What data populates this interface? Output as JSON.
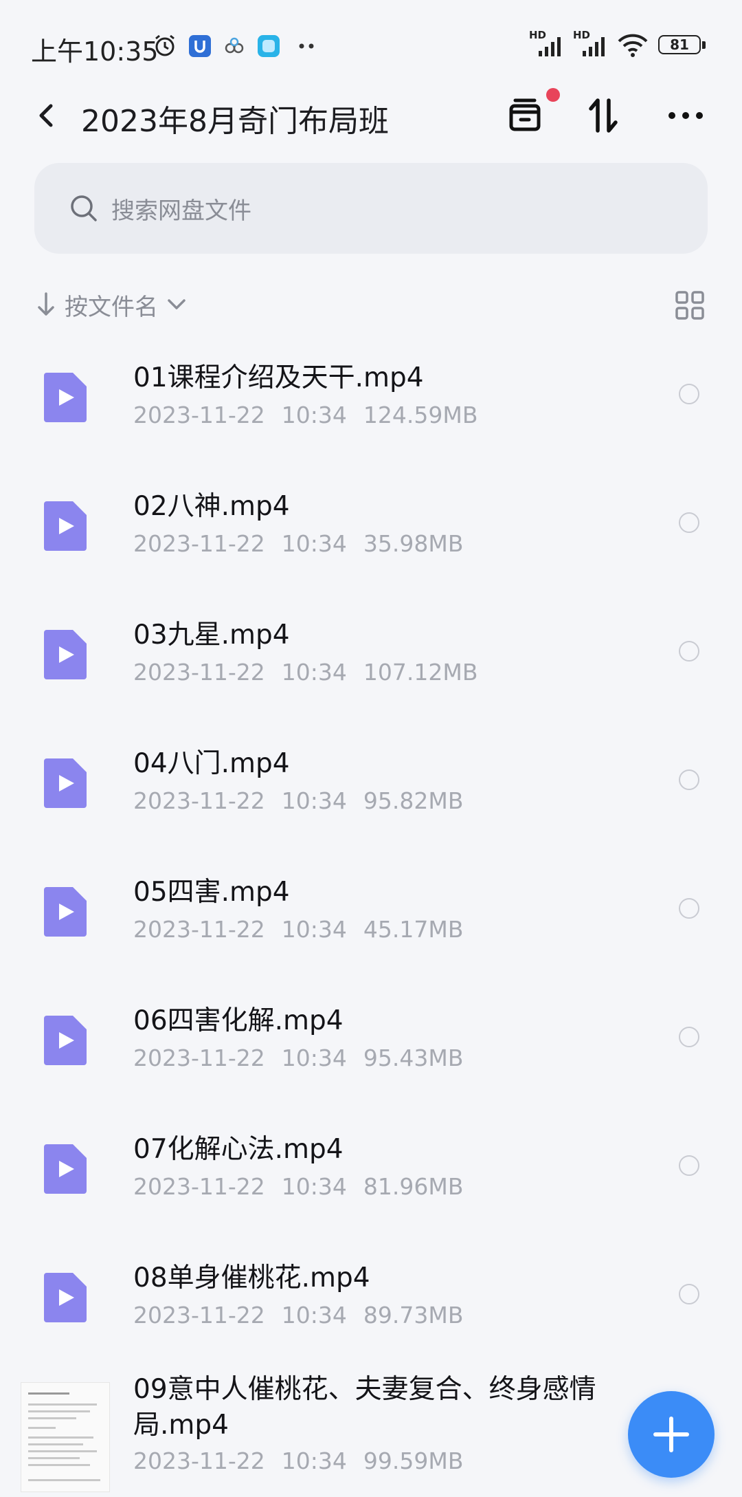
{
  "status_bar": {
    "time": "上午10:35",
    "signal1_label": "HD",
    "signal2_label": "HD",
    "battery": "81"
  },
  "header": {
    "title": "2023年8月奇门布局班",
    "notification_dot_color": "#e8445a"
  },
  "search": {
    "placeholder": "搜索网盘文件"
  },
  "sort": {
    "label": "按文件名"
  },
  "files": [
    {
      "name": "01课程介绍及天干.mp4",
      "date": "2023-11-22",
      "time": "10:34",
      "size": "124.59MB"
    },
    {
      "name": "02八神.mp4",
      "date": "2023-11-22",
      "time": "10:34",
      "size": "35.98MB"
    },
    {
      "name": "03九星.mp4",
      "date": "2023-11-22",
      "time": "10:34",
      "size": "107.12MB"
    },
    {
      "name": "04八门.mp4",
      "date": "2023-11-22",
      "time": "10:34",
      "size": "95.82MB"
    },
    {
      "name": "05四害.mp4",
      "date": "2023-11-22",
      "time": "10:34",
      "size": "45.17MB"
    },
    {
      "name": "06四害化解.mp4",
      "date": "2023-11-22",
      "time": "10:34",
      "size": "95.43MB"
    },
    {
      "name": "07化解心法.mp4",
      "date": "2023-11-22",
      "time": "10:34",
      "size": "81.96MB"
    },
    {
      "name": "08单身催桃花.mp4",
      "date": "2023-11-22",
      "time": "10:34",
      "size": "89.73MB"
    },
    {
      "name": "09意中人催桃花、夫妻复合、终身感情局.mp4",
      "date": "2023-11-22",
      "time": "10:34",
      "size": "99.59MB"
    }
  ],
  "colors": {
    "video_icon": "#8b85ee",
    "fab": "#3b8cf7",
    "background": "#f5f6f9"
  }
}
